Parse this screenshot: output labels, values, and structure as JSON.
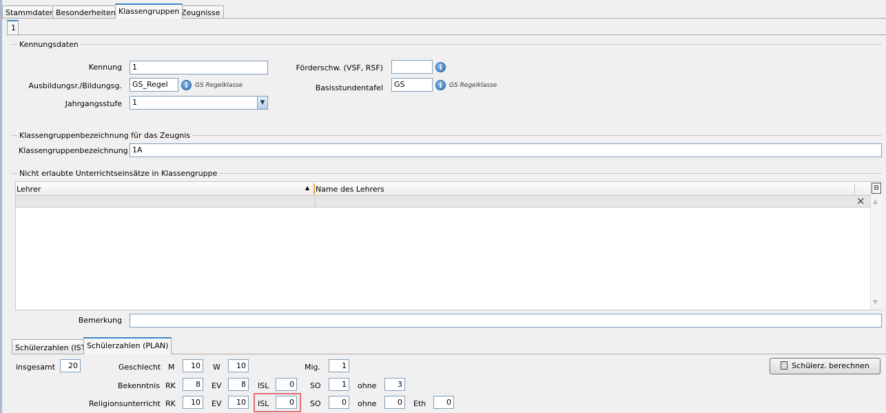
{
  "tabs": [
    "Stammdaten",
    "Besonderheiten",
    "Klassengruppen",
    "Zeugnisse"
  ],
  "sub_tab": "1",
  "kennung_section": {
    "title": "Kennungsdaten",
    "kennung_label": "Kennung",
    "kennung_value": "1",
    "ausbildung_label": "Ausbildungsr./Bildungsg.",
    "ausbildung_value": "GS_Regel",
    "ausbildung_hint": "GS Regelklasse",
    "jahrgang_label": "Jahrgangsstufe",
    "jahrgang_value": "1",
    "foerder_label": "Förderschw. (VSF, RSF)",
    "foerder_value": "",
    "basis_label": "Basisstundentafel",
    "basis_value": "GS",
    "basis_hint": "GS Regelklasse"
  },
  "zeugnis_section": {
    "title": "Klassengruppenbezeichnung für das Zeugnis",
    "label": "Klassengruppenbezeichnung",
    "value": "1A"
  },
  "unterricht_section": {
    "title": "Nicht erlaubte Unterrichtseinsätze in Klassengruppe",
    "columns": [
      "Lehrer",
      "Name des Lehrers"
    ]
  },
  "bemerkung": {
    "label": "Bemerkung",
    "value": ""
  },
  "bottom_tabs": [
    "Schülerzahlen (IST)",
    "Schülerzahlen (PLAN)"
  ],
  "stats": {
    "insgesamt_label": "insgesamt",
    "insgesamt": "20",
    "geschlecht_label": "Geschlecht",
    "m_label": "M",
    "m": "10",
    "w_label": "W",
    "w": "10",
    "mig_label": "Mig.",
    "mig": "1",
    "bekenntnis_label": "Bekenntnis",
    "bek": {
      "rk_label": "RK",
      "rk": "8",
      "ev_label": "EV",
      "ev": "8",
      "isl_label": "ISL",
      "isl": "0",
      "so_label": "SO",
      "so": "1",
      "ohne_label": "ohne",
      "ohne": "3"
    },
    "religion_label": "Religionsunterricht",
    "rel": {
      "rk_label": "RK",
      "rk": "10",
      "ev_label": "EV",
      "ev": "10",
      "isl_label": "ISL",
      "isl": "0",
      "so_label": "SO",
      "so": "0",
      "ohne_label": "ohne",
      "ohne": "0",
      "eth_label": "Eth",
      "eth": "0"
    }
  },
  "calc_button": "Schülerz. berechnen",
  "colors": {
    "accent": "#3d86c9",
    "highlight": "#e06b72"
  }
}
